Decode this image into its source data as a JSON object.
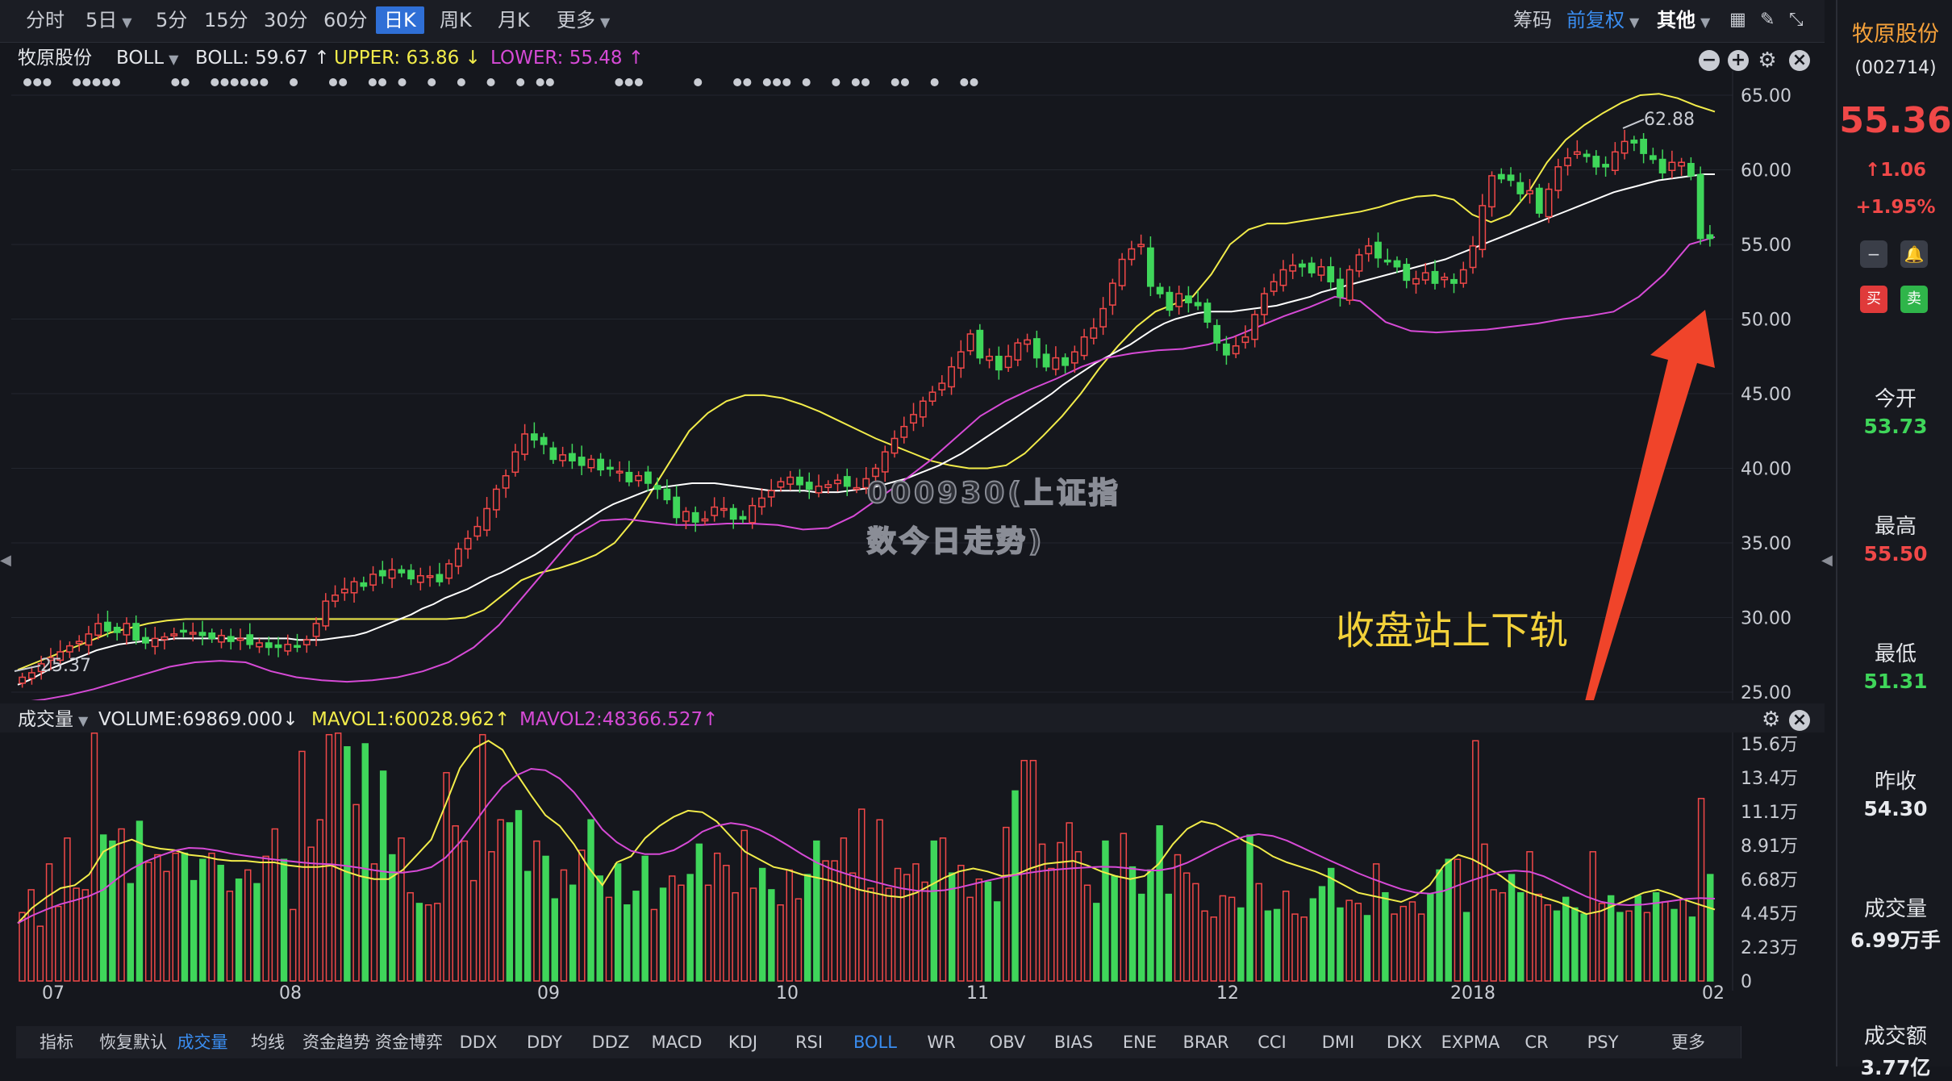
{
  "toolbar": {
    "periods": [
      "分时",
      "5日",
      "5分",
      "15分",
      "30分",
      "60分",
      "日K",
      "周K",
      "月K",
      "更多"
    ],
    "active_period": "日K",
    "chips": "筹码",
    "adjust": "前复权",
    "other": "其他"
  },
  "indicator_line": {
    "stock_name": "牧原股份",
    "indicator": "BOLL",
    "boll": "BOLL: 59.67 ↑",
    "upper": "UPPER: 63.86 ↓",
    "lower": "LOWER: 55.48 ↑"
  },
  "volume_header": {
    "label": "成交量",
    "volume": "VOLUME:69869.000↓",
    "mavol1": "MAVOL1:60028.962↑",
    "mavol2": "MAVOL2:48366.527↑"
  },
  "annotation": "收盘站上下轨",
  "watermark_lines": [
    "000930(上证指",
    "数今日走势)"
  ],
  "price_markers": {
    "high": "62.88",
    "low": "25.37"
  },
  "tabs": [
    "指标",
    "恢复默认",
    "成交量",
    "均线",
    "资金趋势",
    "资金博弈",
    "DDX",
    "DDY",
    "DDZ",
    "MACD",
    "KDJ",
    "RSI",
    "BOLL",
    "WR",
    "OBV",
    "BIAS",
    "ENE",
    "BRAR",
    "CCI",
    "DMI",
    "DKX",
    "EXPMA",
    "CR",
    "PSY",
    "更多"
  ],
  "selected_tabs": [
    "成交量",
    "BOLL"
  ],
  "right_panel": {
    "name": "牧原股份",
    "code": "(002714)",
    "price": "55.36",
    "change": "↑1.06",
    "change_pct": "+1.95%",
    "buy": "买",
    "sell": "卖",
    "stats": [
      {
        "label": "今开",
        "value": "53.73",
        "color": "#3fd65a"
      },
      {
        "label": "最高",
        "value": "55.50",
        "color": "#f04848"
      },
      {
        "label": "最低",
        "value": "51.31",
        "color": "#3fd65a"
      },
      {
        "label": "昨收",
        "value": "54.30",
        "color": "#e8eaee"
      },
      {
        "label": "成交量",
        "value": "6.99万手",
        "color": "#e8eaee"
      },
      {
        "label": "成交额",
        "value": "3.77亿",
        "color": "#e8eaee"
      }
    ]
  },
  "colors": {
    "up": "#f04848",
    "down": "#3fd65a",
    "upper": "#f2ec4a",
    "mid": "#ffffff",
    "lower": "#d64ad6",
    "accent": "#3a8df0"
  },
  "chart_data": {
    "type": "candlestick",
    "y_range": [
      25,
      65
    ],
    "y_ticks": [
      "65.00",
      "60.00",
      "55.00",
      "50.00",
      "45.00",
      "40.00",
      "35.00",
      "30.00",
      "25.00"
    ],
    "x_ticks": [
      "07",
      "08",
      "09",
      "10",
      "11",
      "12",
      "2018",
      "02"
    ],
    "series_names": [
      "BOLL",
      "UPPER",
      "LOWER"
    ],
    "close": [
      26.0,
      26.3,
      26.9,
      27.3,
      27.7,
      28.1,
      28.4,
      28.9,
      29.6,
      29.1,
      29.0,
      29.6,
      28.5,
      28.3,
      28.6,
      28.7,
      28.9,
      29.1,
      29.0,
      28.8,
      28.6,
      28.8,
      28.4,
      28.6,
      28.2,
      28.3,
      28.0,
      28.0,
      28.2,
      28.1,
      28.5,
      29.6,
      31.1,
      31.5,
      31.9,
      32.4,
      32.1,
      32.9,
      32.8,
      33.2,
      33.0,
      32.6,
      32.8,
      32.8,
      32.4,
      33.6,
      34.6,
      35.3,
      36.1,
      37.3,
      38.6,
      39.5,
      41.1,
      42.3,
      41.9,
      41.6,
      40.6,
      40.9,
      40.5,
      40.2,
      40.6,
      39.9,
      40.0,
      39.8,
      39.1,
      39.5,
      39.0,
      38.6,
      37.9,
      36.7,
      37.1,
      36.4,
      36.6,
      37.4,
      37.3,
      36.6,
      36.6,
      37.5,
      38.0,
      38.5,
      39.1,
      39.4,
      38.9,
      38.6,
      38.8,
      38.9,
      39.2,
      38.8,
      38.7,
      39.3,
      40.0,
      41.1,
      42.0,
      42.8,
      43.6,
      44.5,
      45.1,
      45.7,
      46.8,
      47.8,
      49.0,
      47.4,
      47.5,
      46.6,
      47.5,
      48.4,
      48.6,
      47.4,
      46.8,
      47.4,
      46.9,
      47.8,
      48.8,
      49.4,
      50.7,
      52.4,
      54.0,
      54.7,
      55.0,
      52.2,
      51.7,
      50.6,
      51.7,
      51.1,
      50.9,
      49.8,
      48.4,
      47.6,
      48.2,
      48.8,
      50.3,
      51.7,
      52.5,
      53.3,
      53.6,
      53.5,
      53.1,
      53.5,
      52.5,
      51.5,
      53.3,
      54.3,
      54.9,
      54.1,
      53.9,
      53.5,
      52.6,
      52.7,
      53.1,
      52.4,
      52.8,
      52.4,
      53.3,
      54.9,
      57.6,
      59.6,
      59.4,
      59.3,
      58.4,
      58.6,
      57.1,
      58.7,
      60.2,
      60.8,
      61.2,
      60.9,
      60.2,
      60.2,
      61.2,
      61.9,
      61.8,
      61.1,
      60.7,
      59.8,
      60.5,
      60.5,
      59.6,
      55.4,
      55.4
    ],
    "boll": [
      25.5,
      25.8,
      26.2,
      26.6,
      26.9,
      27.2,
      27.5,
      27.8,
      28.0,
      28.2,
      28.3,
      28.4,
      28.5,
      28.5,
      28.6,
      28.6,
      28.6,
      28.6,
      28.6,
      28.6,
      28.6,
      28.6,
      28.6,
      28.6,
      28.6,
      28.5,
      28.5,
      28.5,
      28.6,
      28.7,
      28.8,
      29.0,
      29.3,
      29.6,
      29.9,
      30.2,
      30.6,
      30.9,
      31.3,
      31.6,
      31.9,
      32.3,
      32.7,
      33.0,
      33.4,
      33.8,
      34.2,
      34.7,
      35.2,
      35.7,
      36.2,
      36.7,
      37.2,
      37.6,
      37.9,
      38.2,
      38.5,
      38.7,
      38.8,
      38.9,
      39.0,
      39.0,
      39.0,
      38.9,
      38.8,
      38.7,
      38.6,
      38.5,
      38.5,
      38.5,
      38.5,
      38.4,
      38.4,
      38.4,
      38.5,
      38.6,
      38.7,
      38.9,
      39.1,
      39.3,
      39.6,
      39.9,
      40.2,
      40.6,
      41.0,
      41.5,
      42.0,
      42.5,
      43.0,
      43.5,
      44.0,
      44.5,
      45.0,
      45.6,
      46.1,
      46.6,
      47.1,
      47.5,
      47.9,
      48.3,
      48.8,
      49.3,
      49.7,
      50.0,
      50.2,
      50.4,
      50.5,
      50.5,
      50.5,
      50.6,
      50.7,
      50.8,
      50.9,
      51.1,
      51.3,
      51.5,
      51.8,
      52.0,
      52.2,
      52.4,
      52.6,
      52.8,
      53.0,
      53.2,
      53.4,
      53.6,
      53.8,
      54.0,
      54.3,
      54.6,
      54.9,
      55.2,
      55.5,
      55.8,
      56.1,
      56.4,
      56.7,
      57.0,
      57.3,
      57.6,
      57.9,
      58.2,
      58.5,
      58.7,
      58.9,
      59.1,
      59.3,
      59.4,
      59.5,
      59.6,
      59.7,
      59.7
    ],
    "upper": [
      26.5,
      27.0,
      27.5,
      28.0,
      28.5,
      29.0,
      29.3,
      29.6,
      29.8,
      29.9,
      29.9,
      29.9,
      29.9,
      29.9,
      29.9,
      29.9,
      29.9,
      29.9,
      29.9,
      29.9,
      29.9,
      29.9,
      29.9,
      29.9,
      30.0,
      30.5,
      31.5,
      32.5,
      33.0,
      33.3,
      33.7,
      34.2,
      35.0,
      36.5,
      38.5,
      40.5,
      42.5,
      43.7,
      44.5,
      44.9,
      44.9,
      44.7,
      44.3,
      43.8,
      43.2,
      42.6,
      42.0,
      41.5,
      41.0,
      40.5,
      40.2,
      40.0,
      40.0,
      40.2,
      41.0,
      42.2,
      43.5,
      45.0,
      46.7,
      48.2,
      49.5,
      50.5,
      51.0,
      51.5,
      53.0,
      55.0,
      56.0,
      56.4,
      56.4,
      56.6,
      56.8,
      57.0,
      57.2,
      57.5,
      57.9,
      58.2,
      58.3,
      58.0,
      57.0,
      56.5,
      57.0,
      58.5,
      60.5,
      62.0,
      63.0,
      63.8,
      64.5,
      65.0,
      65.1,
      64.8,
      64.3,
      63.9
    ],
    "lower": [
      24.3,
      24.5,
      24.8,
      25.2,
      25.7,
      26.2,
      26.7,
      27.0,
      27.1,
      27.0,
      26.4,
      26.0,
      25.8,
      25.7,
      25.8,
      26.0,
      26.4,
      27.0,
      28.0,
      29.5,
      31.5,
      33.5,
      35.5,
      36.5,
      36.6,
      36.4,
      36.2,
      36.2,
      36.3,
      36.3,
      36.2,
      35.9,
      36.0,
      36.8,
      38.0,
      39.2,
      40.5,
      42.0,
      43.5,
      44.5,
      45.3,
      46.0,
      46.8,
      47.4,
      47.7,
      47.9,
      48.0,
      48.3,
      48.8,
      49.5,
      50.2,
      50.8,
      51.5,
      51.2,
      49.8,
      49.2,
      49.1,
      49.2,
      49.3,
      49.5,
      49.7,
      50.0,
      50.2,
      50.5,
      51.5,
      53.0,
      55.0,
      55.5
    ]
  },
  "volume_data": {
    "y_ticks": [
      "15.6万",
      "13.4万",
      "11.1万",
      "8.91万",
      "6.68万",
      "4.45万",
      "2.23万",
      "0"
    ],
    "values": [
      4.5,
      6.0,
      3.6,
      7.7,
      4.9,
      9.4,
      6.1,
      6.0,
      16.5,
      9.6,
      9.2,
      10.0,
      6.4,
      10.5,
      7.8,
      8.3,
      7.2,
      8.4,
      8.4,
      6.6,
      8.0,
      8.4,
      7.6,
      5.9,
      6.7,
      7.3,
      6.4,
      8.2,
      10.0,
      8.0,
      4.7,
      15.1,
      8.8,
      10.6,
      16.2,
      16.3,
      15.4,
      11.6,
      15.6,
      7.7,
      13.8,
      8.3,
      9.4,
      5.8,
      5.1,
      5.0,
      5.1,
      13.7,
      10.2,
      9.2,
      6.6,
      16.2,
      8.5,
      10.6,
      10.4,
      11.2,
      7.2,
      9.2,
      8.2,
      5.4,
      7.3,
      6.3,
      8.6,
      10.6,
      6.9,
      5.5,
      7.7,
      5.0,
      5.9,
      8.2,
      4.7,
      6.1,
      6.9,
      6.3,
      7.0,
      9.0,
      6.3,
      8.4,
      7.6,
      5.8,
      9.9,
      6.1,
      7.4,
      6.0,
      5.0,
      7.3,
      5.4,
      7.0,
      9.2,
      7.9,
      7.9,
      9.4,
      7.1,
      11.3,
      6.1,
      10.6,
      6.1,
      7.4,
      7.0,
      7.7,
      6.5,
      9.2,
      9.4,
      7.1,
      7.6,
      5.5,
      6.7,
      6.5,
      5.2,
      10.1,
      12.5,
      14.5,
      14.5,
      9.0,
      7.4,
      9.1,
      10.4,
      8.5,
      6.3,
      5.1,
      9.2,
      6.9,
      9.7,
      7.5,
      5.7,
      7.3,
      10.2,
      5.7,
      8.3,
      7.1,
      6.4,
      4.6,
      4.2,
      5.6,
      5.5,
      4.8,
      9.6,
      6.4,
      4.6,
      4.7,
      5.9,
      4.4,
      4.2,
      5.4,
      6.2,
      7.4,
      4.8,
      5.3,
      5.1,
      4.3,
      7.7,
      5.8,
      4.4,
      4.9,
      5.2,
      4.4,
      5.7,
      7.3,
      8.0,
      8.0,
      4.5,
      15.8,
      9.0,
      6.0,
      5.8,
      7.0,
      5.8,
      8.5,
      5.7,
      5.0,
      4.6,
      5.5,
      4.8,
      4.4,
      8.5,
      5.1,
      5.6,
      4.5,
      4.6,
      5.6,
      4.5,
      5.8,
      5.2,
      4.7,
      5.4,
      4.2,
      12.0,
      7.0
    ],
    "mavol1": [
      3.8,
      4.8,
      5.5,
      6.1,
      6.3,
      7.0,
      8.5,
      9.0,
      9.3,
      8.9,
      8.7,
      8.6,
      8.3,
      8.2,
      8.0,
      7.9,
      7.9,
      7.8,
      7.8,
      7.6,
      7.5,
      7.5,
      7.6,
      7.2,
      6.9,
      6.7,
      6.7,
      7.3,
      8.3,
      9.3,
      11.6,
      14.0,
      15.3,
      15.8,
      15.2,
      13.6,
      12.2,
      10.9,
      10.2,
      9.0,
      7.5,
      6.3,
      7.8,
      8.2,
      9.4,
      10.2,
      10.8,
      11.2,
      11.1,
      10.5,
      9.5,
      8.5,
      8.0,
      7.5,
      7.3,
      7.0,
      6.8,
      6.6,
      6.3,
      6.0,
      5.8,
      5.6,
      5.5,
      5.8,
      6.3,
      6.8,
      7.2,
      7.4,
      7.2,
      6.9,
      7.0,
      7.4,
      7.7,
      7.8,
      7.9,
      7.6,
      7.2,
      6.9,
      6.7,
      6.9,
      7.7,
      9.0,
      10.0,
      10.5,
      10.3,
      9.8,
      9.2,
      8.8,
      8.2,
      7.8,
      7.5,
      7.2,
      6.8,
      6.3,
      5.8,
      5.6,
      5.4,
      5.2,
      5.6,
      6.3,
      7.6,
      8.3,
      8.0,
      7.5,
      6.9,
      6.2,
      5.8,
      5.5,
      5.2,
      4.8,
      4.4,
      4.6,
      5.0,
      5.4,
      5.8,
      6.0,
      5.7,
      5.3,
      5.0,
      4.7
    ]
  }
}
